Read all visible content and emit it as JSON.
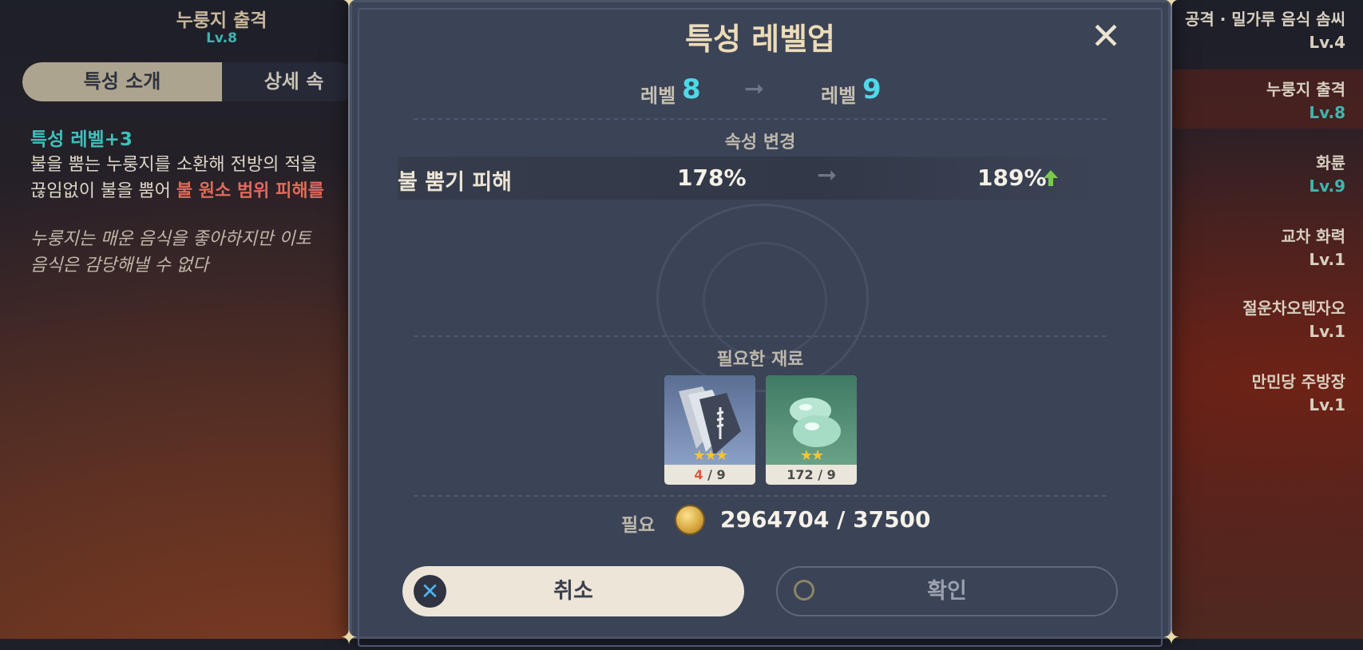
{
  "left": {
    "talent_name": "누룽지 출격",
    "talent_level": "Lv.8",
    "tabs": [
      "특성 소개",
      "상세 속"
    ],
    "desc_head": "특성 레벨+3",
    "desc_line1": "불을 뿜는 누룽지를 소환해 전방의 적을",
    "desc_line2_prefix": "끊임없이 불을 뿜어 ",
    "desc_line2_highlight": "불 원소 범위 피해를",
    "quote_line1": "누룽지는 매운 음식을 좋아하지만 이토",
    "quote_line2": "음식은 감당해낼 수 없다"
  },
  "right_list": [
    {
      "name": "공격 · 밀가루 음식 솜씨",
      "level": "Lv.4"
    },
    {
      "name": "누룽지 출격",
      "level": "Lv.8"
    },
    {
      "name": "화륜",
      "level": "Lv.9"
    },
    {
      "name": "교차 화력",
      "level": "Lv.1"
    },
    {
      "name": "절운차오텐자오",
      "level": "Lv.1"
    },
    {
      "name": "만민당 주방장",
      "level": "Lv.1"
    }
  ],
  "dialog": {
    "title": "특성 레벨업",
    "close_icon": "close-icon",
    "level_label": "레벨",
    "level_from": "8",
    "level_to": "9",
    "attr_section": "속성 변경",
    "attr_name": "불 뿜기 피해",
    "attr_old": "178%",
    "attr_new": "189%",
    "materials_section": "필요한 재료",
    "materials": [
      {
        "icon": "talent-book-icon",
        "have": "4",
        "need": "/ 9",
        "stars": "★★★",
        "short": true
      },
      {
        "icon": "slime-condensate-icon",
        "have": "172",
        "need": "/ 9",
        "stars": "★★",
        "short": false
      }
    ],
    "cost_label": "필요",
    "cost_value": "2964704 / 37500",
    "cancel_label": "취소",
    "confirm_label": "확인"
  },
  "colors": {
    "accent_teal": "#4fd8e8",
    "up_green": "#7cc84a",
    "fire_red": "#e06b5c"
  }
}
